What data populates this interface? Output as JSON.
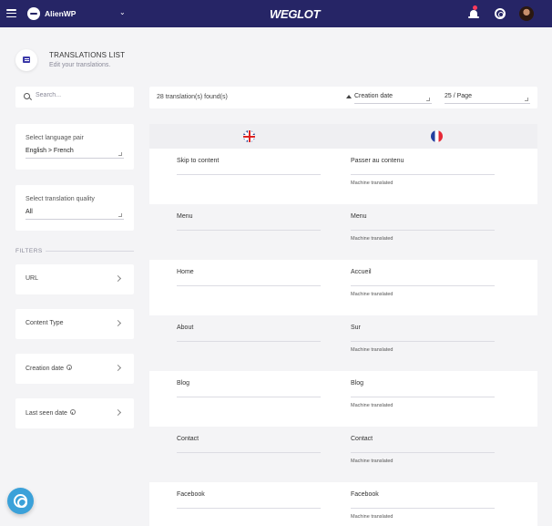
{
  "topbar": {
    "project_name": "AlienWP",
    "brand": "WEGLOT",
    "colors": {
      "nav_bg": "#262566",
      "notification": "#ff3b5c"
    }
  },
  "header": {
    "title": "TRANSLATIONS LIST",
    "subtitle": "Edit your translations.",
    "icon": "chat-list-icon"
  },
  "search": {
    "placeholder": "Search..."
  },
  "language_pair": {
    "label": "Select language pair",
    "value": "English > French"
  },
  "quality": {
    "label": "Select translation quality",
    "value": "All"
  },
  "filters": {
    "heading": "FILTERS",
    "items": [
      {
        "label": "URL"
      },
      {
        "label": "Content Type"
      },
      {
        "label": "Creation date"
      },
      {
        "label": "Last seen date"
      }
    ]
  },
  "toolbar": {
    "count": "28 translation(s) found(s)",
    "sort": "Creation date",
    "per_page": "25 / Page"
  },
  "table": {
    "source_flag": "uk-flag-icon",
    "target_flag": "france-flag-icon",
    "rows": [
      {
        "source": "Skip to content",
        "target": "Passer au contenu",
        "status": "Machine translated"
      },
      {
        "source": "Menu",
        "target": "Menu",
        "status": "Machine translated"
      },
      {
        "source": "Home",
        "target": "Accueil",
        "status": "Machine translated"
      },
      {
        "source": "About",
        "target": "Sur",
        "status": "Machine translated"
      },
      {
        "source": "Blog",
        "target": "Blog",
        "status": "Machine translated"
      },
      {
        "source": "Contact",
        "target": "Contact",
        "status": "Machine translated"
      },
      {
        "source": "Facebook",
        "target": "Facebook",
        "status": "Machine translated"
      }
    ]
  }
}
